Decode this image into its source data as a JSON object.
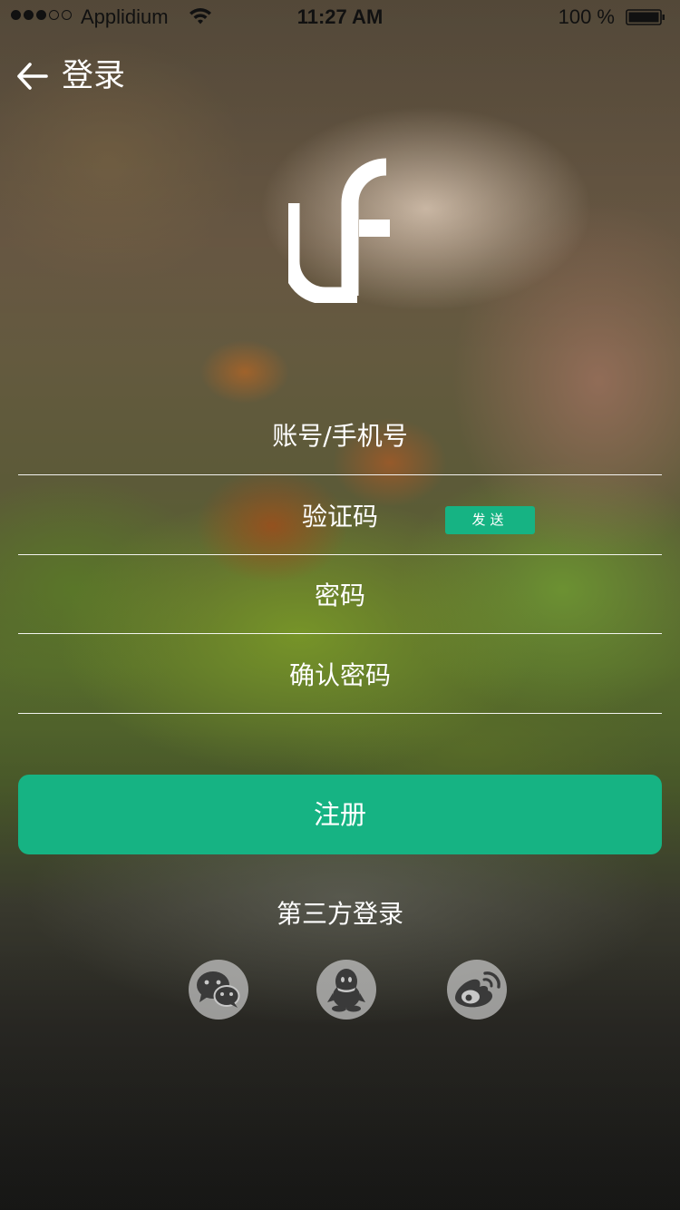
{
  "status_bar": {
    "carrier": "Applidium",
    "time": "11:27 AM",
    "battery": "100 %"
  },
  "nav": {
    "title": "登录"
  },
  "form": {
    "account_label": "账号/手机号",
    "code_label": "验证码",
    "send_label": "发送",
    "password_label": "密码",
    "confirm_label": "确认密码"
  },
  "actions": {
    "register_label": "注册"
  },
  "third_party": {
    "title": "第三方登录",
    "providers": [
      "wechat-icon",
      "qq-icon",
      "weibo-icon"
    ]
  },
  "colors": {
    "accent": "#16b383",
    "social_bg": "#c8c8c8",
    "icon_fg": "#3a3a3a"
  }
}
